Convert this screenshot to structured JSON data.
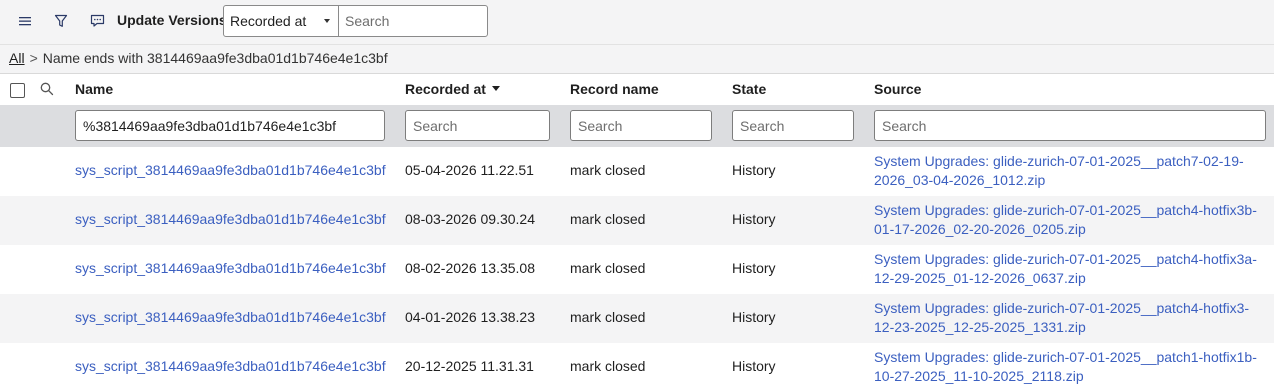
{
  "toolbar": {
    "title": "Update Versions",
    "select_value": "Recorded at",
    "search_placeholder": "Search"
  },
  "breadcrumb": {
    "all": "All",
    "separator": ">",
    "condition": "Name ends with 3814469aa9fe3dba01d1b746e4e1c3bf"
  },
  "columns": {
    "name": "Name",
    "recorded_at": "Recorded at",
    "record_name": "Record name",
    "state": "State",
    "source": "Source"
  },
  "filters": {
    "name_value": "%3814469aa9fe3dba01d1b746e4e1c3bf",
    "placeholder": "Search"
  },
  "rows": [
    {
      "name": "sys_script_3814469aa9fe3dba01d1b746e4e1c3bf",
      "recorded_at": "05-04-2026 11.22.51",
      "record_name": "mark closed",
      "state": "History",
      "source": "System Upgrades: glide-zurich-07-01-2025__patch7-02-19-2026_03-04-2026_1012.zip"
    },
    {
      "name": "sys_script_3814469aa9fe3dba01d1b746e4e1c3bf",
      "recorded_at": "08-03-2026 09.30.24",
      "record_name": "mark closed",
      "state": "History",
      "source": "System Upgrades: glide-zurich-07-01-2025__patch4-hotfix3b-01-17-2026_02-20-2026_0205.zip"
    },
    {
      "name": "sys_script_3814469aa9fe3dba01d1b746e4e1c3bf",
      "recorded_at": "08-02-2026 13.35.08",
      "record_name": "mark closed",
      "state": "History",
      "source": "System Upgrades: glide-zurich-07-01-2025__patch4-hotfix3a-12-29-2025_01-12-2026_0637.zip"
    },
    {
      "name": "sys_script_3814469aa9fe3dba01d1b746e4e1c3bf",
      "recorded_at": "04-01-2026 13.38.23",
      "record_name": "mark closed",
      "state": "History",
      "source": "System Upgrades: glide-zurich-07-01-2025__patch4-hotfix3-12-23-2025_12-25-2025_1331.zip"
    },
    {
      "name": "sys_script_3814469aa9fe3dba01d1b746e4e1c3bf",
      "recorded_at": "20-12-2025 11.31.31",
      "record_name": "mark closed",
      "state": "History",
      "source": "System Upgrades: glide-zurich-07-01-2025__patch1-hotfix1b-10-27-2025_11-10-2025_2118.zip"
    }
  ],
  "icons": {
    "menu": "hamburger-icon",
    "filter": "funnel-icon",
    "chat": "chat-icon",
    "search": "magnifier-icon"
  },
  "colors": {
    "link": "#3b5fc0",
    "toolbar_bg": "#f4f4f5",
    "filter_row_bg": "#dcdde0"
  }
}
